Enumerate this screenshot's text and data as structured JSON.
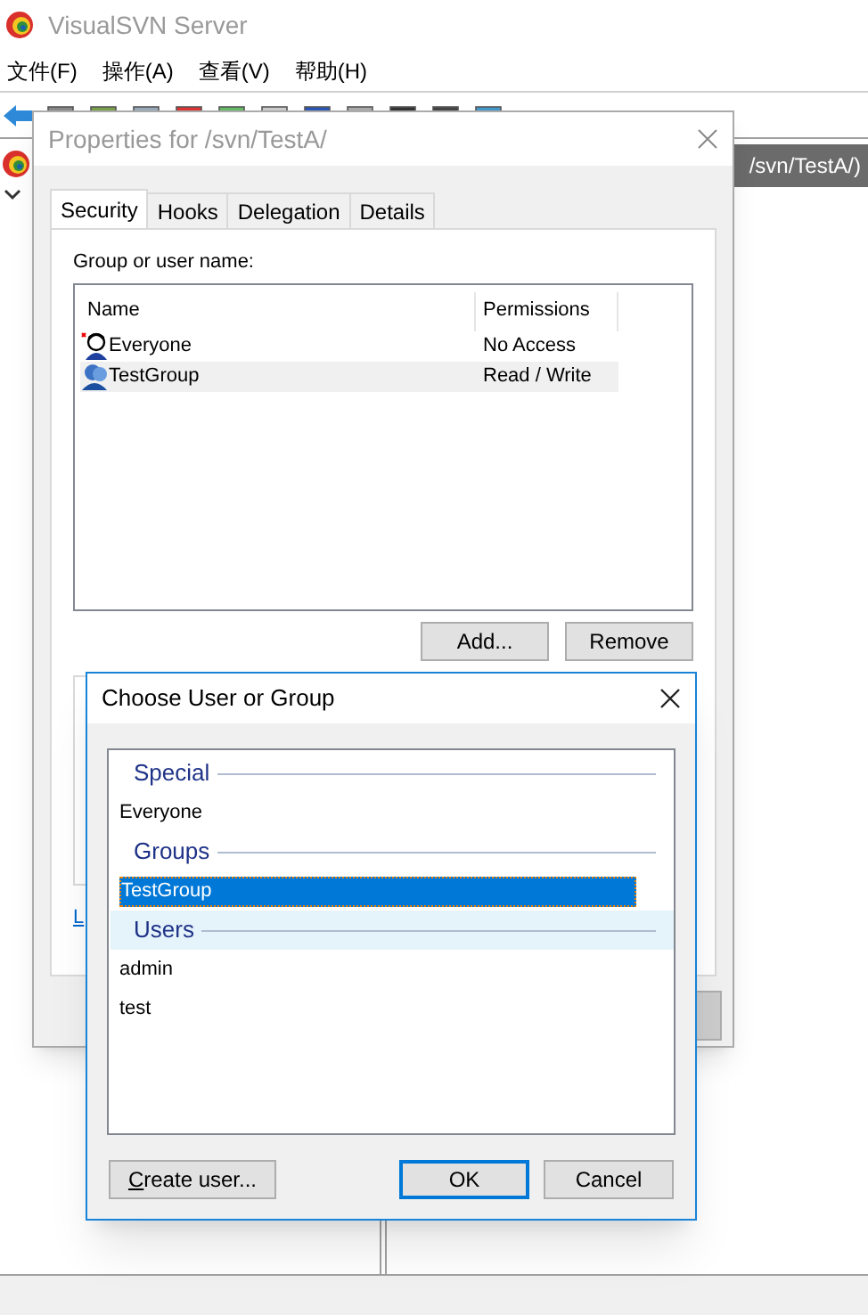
{
  "window": {
    "title": "VisualSVN Server"
  },
  "menu": [
    "文件(F)",
    "操作(A)",
    "查看(V)",
    "帮助(H)"
  ],
  "content_header": "/svn/TestA/)",
  "properties_dialog": {
    "title": "Properties for /svn/TestA/",
    "tabs": [
      {
        "label": "Security",
        "selected": true
      },
      {
        "label": "Hooks",
        "selected": false
      },
      {
        "label": "Delegation",
        "selected": false
      },
      {
        "label": "Details",
        "selected": false
      }
    ],
    "group_label": "Group or user name:",
    "columns": [
      "Name",
      "Permissions"
    ],
    "rows": [
      {
        "name": "Everyone",
        "permissions": "No Access",
        "kind": "special",
        "selected": false
      },
      {
        "name": "TestGroup",
        "permissions": "Read / Write",
        "kind": "group",
        "selected": true
      }
    ],
    "buttons": [
      "Add...",
      "Remove"
    ],
    "link": "L"
  },
  "choose_dialog": {
    "title": "Choose User or Group",
    "sections": [
      {
        "heading": "Special",
        "hovered": false,
        "items": [
          {
            "label": "Everyone",
            "selected": false
          }
        ]
      },
      {
        "heading": "Groups",
        "hovered": false,
        "items": [
          {
            "label": "TestGroup",
            "selected": true
          }
        ]
      },
      {
        "heading": "Users",
        "hovered": true,
        "items": [
          {
            "label": "admin",
            "selected": false
          },
          {
            "label": "test",
            "selected": false
          }
        ]
      }
    ],
    "create_button": "Create user...",
    "ok_button": "OK",
    "cancel_button": "Cancel"
  }
}
